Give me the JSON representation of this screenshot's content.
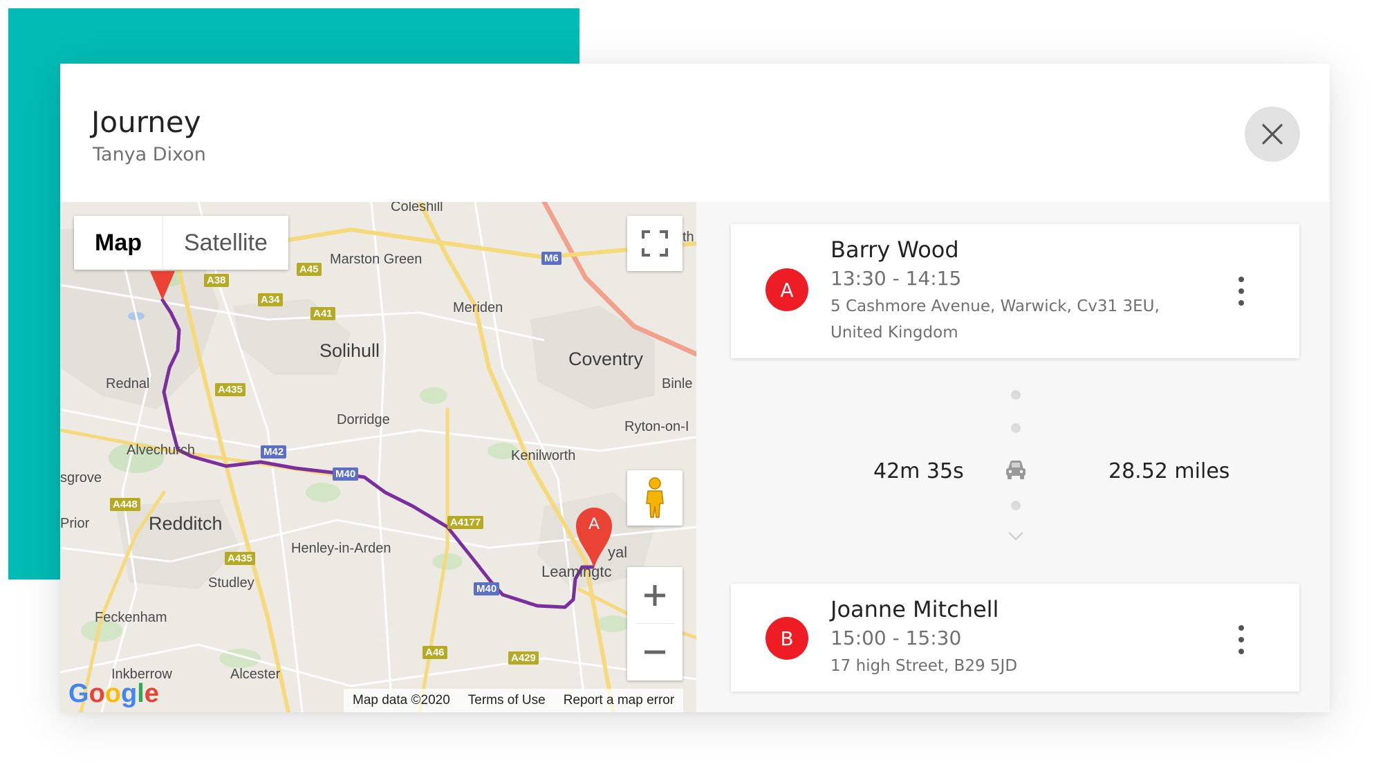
{
  "colors": {
    "accent": "#00bcb4",
    "marker": "#ee1c25",
    "route": "#7b2e9e",
    "close_bg": "#e1e1e1"
  },
  "modal": {
    "title": "Journey",
    "subtitle": "Tanya Dixon",
    "close_icon": "close-icon"
  },
  "map": {
    "type_control": {
      "map_label": "Map",
      "satellite_label": "Satellite",
      "selected": "Map"
    },
    "towns": {
      "coleshill": "Coleshill",
      "marston_green": "Marston Green",
      "meriden": "Meriden",
      "solihull": "Solihull",
      "coventry": "Coventry",
      "binley": "Binle",
      "rednal": "Rednal",
      "dorridge": "Dorridge",
      "ryton": "Ryton-on-I",
      "alvechurch": "Alvechurch",
      "kenilworth": "Kenilworth",
      "cosgrove": "sgrove",
      "prior": "Prior",
      "redditch": "Redditch",
      "henley": "Henley-in-Arden",
      "royal": "yal",
      "leamington": "Leamingtc",
      "studley": "Studley",
      "feckenham": "Feckenham",
      "inkberrow": "Inkberrow",
      "alcester": "Alcester",
      "north": "th"
    },
    "roads": {
      "a38": "A38",
      "a45": "A45",
      "m6": "M6",
      "a34": "A34",
      "a41": "A41",
      "a435": "A435",
      "m42": "M42",
      "m40a": "M40",
      "a4177": "A4177",
      "a448": "A448",
      "a435b": "A435",
      "m40b": "M40",
      "a46": "A46",
      "a429": "A429"
    },
    "marker_label": "A",
    "google_logo": "Google",
    "attribution": {
      "map_data": "Map data ©2020",
      "terms": "Terms of Use",
      "report": "Report a map error"
    },
    "icons": {
      "fullscreen": "fullscreen-icon",
      "pegman": "pegman-icon",
      "zoom_in": "plus-icon",
      "zoom_out": "minus-icon"
    }
  },
  "stops": [
    {
      "badge": "A",
      "name": "Barry Wood",
      "time": "13:30 - 14:15",
      "address": "5 Cashmore Avenue, Warwick, Cv31 3EU, United Kingdom"
    },
    {
      "badge": "B",
      "name": "Joanne Mitchell",
      "time": "15:00 - 15:30",
      "address": "17 high Street, B29 5JD"
    }
  ],
  "leg": {
    "duration": "42m 35s",
    "distance": "28.52 miles",
    "icon": "car-icon"
  }
}
